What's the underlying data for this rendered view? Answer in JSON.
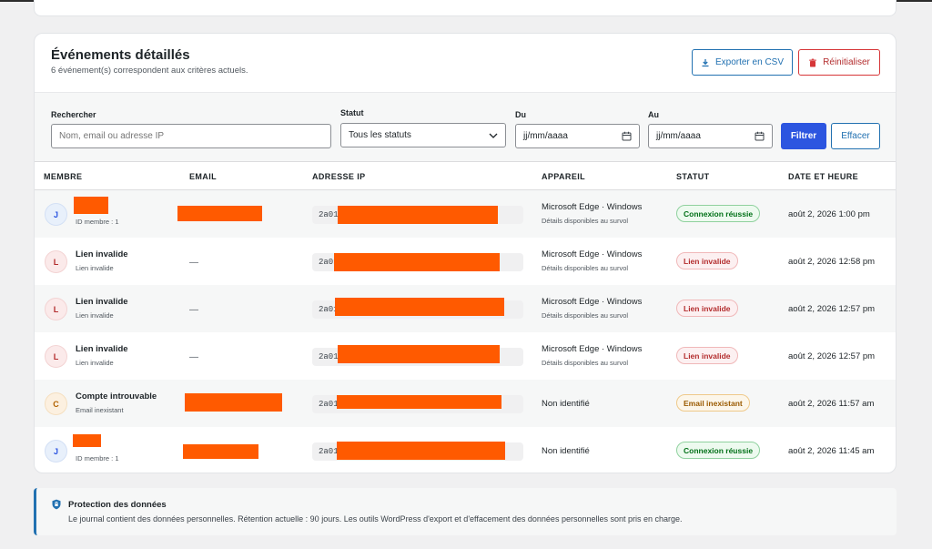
{
  "header": {
    "title": "Événements détaillés",
    "subtitle": "6 événement(s) correspondent aux critères actuels.",
    "export_label": "Exporter en CSV",
    "reset_label": "Réinitialiser"
  },
  "filters": {
    "search_label": "Rechercher",
    "search_placeholder": "Nom, email ou adresse IP",
    "status_label": "Statut",
    "status_value": "Tous les statuts",
    "from_label": "Du",
    "from_placeholder": "jj/mm/aaaa",
    "to_label": "Au",
    "to_placeholder": "jj/mm/aaaa",
    "filter_button": "Filtrer",
    "clear_button": "Effacer"
  },
  "table": {
    "columns": [
      "MEMBRE",
      "EMAIL",
      "ADRESSE IP",
      "APPAREIL",
      "STATUT",
      "DATE ET HEURE"
    ],
    "rows": [
      {
        "initial": "J",
        "name": "",
        "sub": "ID membre : 1",
        "email": "",
        "ip": "2a01",
        "device": "Microsoft Edge · Windows",
        "device_sub": "Détails disponibles au survol",
        "status": "Connexion réussie",
        "datetime": "août 2, 2026 1:00 pm"
      },
      {
        "initial": "L",
        "name": "Lien invalide",
        "sub": "Lien invalide",
        "email": "—",
        "ip": "2a01",
        "device": "Microsoft Edge · Windows",
        "device_sub": "Détails disponibles au survol",
        "status": "Lien invalide",
        "datetime": "août 2, 2026 12:58 pm"
      },
      {
        "initial": "L",
        "name": "Lien invalide",
        "sub": "Lien invalide",
        "email": "—",
        "ip": "2a01",
        "device": "Microsoft Edge · Windows",
        "device_sub": "Détails disponibles au survol",
        "status": "Lien invalide",
        "datetime": "août 2, 2026 12:57 pm"
      },
      {
        "initial": "L",
        "name": "Lien invalide",
        "sub": "Lien invalide",
        "email": "—",
        "ip": "2a01",
        "device": "Microsoft Edge · Windows",
        "device_sub": "Détails disponibles au survol",
        "status": "Lien invalide",
        "datetime": "août 2, 2026 12:57 pm"
      },
      {
        "initial": "C",
        "name": "Compte introuvable",
        "sub": "Email inexistant",
        "email": "",
        "ip": "2a01",
        "device": "Non identifié",
        "device_sub": "",
        "status": "Email inexistant",
        "datetime": "août 2, 2026 11:57 am"
      },
      {
        "initial": "J",
        "name": "",
        "sub": "ID membre : 1",
        "email": "",
        "ip": "2a01",
        "device": "Non identifié",
        "device_sub": "",
        "status": "Connexion réussie",
        "datetime": "août 2, 2026 11:45 am"
      }
    ]
  },
  "notice": {
    "title": "Protection des données",
    "text": "Le journal contient des données personnelles. Rétention actuelle : 90 jours. Les outils WordPress d'export et d'effacement des données personnelles sont pris en charge."
  },
  "colors": {
    "accent": "#2271b1",
    "filter_button": "#2c55e0",
    "danger": "#d63638",
    "redaction": "#ff5a00"
  },
  "icons": {
    "export": "download-icon",
    "reset": "trash-icon",
    "select": "chevron-down-icon",
    "date": "calendar-icon",
    "notice": "shield-lock-icon"
  }
}
